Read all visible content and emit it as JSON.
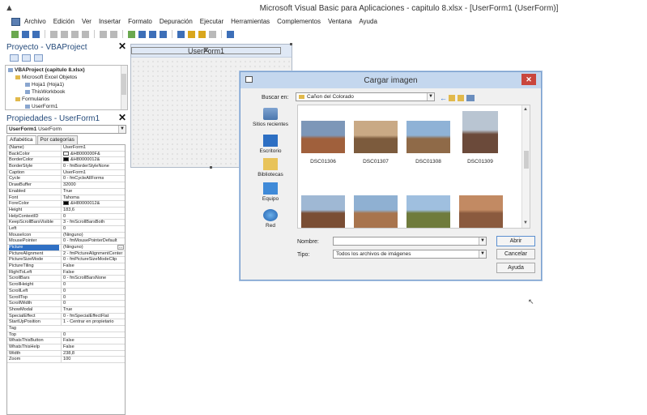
{
  "window": {
    "title": "Microsoft Visual Basic para Aplicaciones - capitulo 8.xlsx - [UserForm1 (UserForm)]"
  },
  "menu": [
    "Archivo",
    "Edición",
    "Ver",
    "Insertar",
    "Formato",
    "Depuración",
    "Ejecutar",
    "Herramientas",
    "Complementos",
    "Ventana",
    "Ayuda"
  ],
  "project": {
    "title": "Proyecto - VBAProject",
    "tree": [
      "VBAProject (capitulo 8.xlsx)",
      "Microsoft Excel Objetos",
      "Hoja1 (Hoja1)",
      "ThisWorkbook",
      "Formularios",
      "UserForm1"
    ]
  },
  "properties": {
    "title": "Propiedades - UserForm1",
    "object_name": "UserForm1",
    "object_type": "UserForm",
    "tabs": [
      "Alfabética",
      "Por categorías"
    ],
    "rows": [
      {
        "name": "(Name)",
        "value": "UserForm1"
      },
      {
        "name": "BackColor",
        "value": "&H8000000F&",
        "swatch": "#ffffff"
      },
      {
        "name": "BorderColor",
        "value": "&H80000012&",
        "swatch": "#000000"
      },
      {
        "name": "BorderStyle",
        "value": "0 - fmBorderStyleNone"
      },
      {
        "name": "Caption",
        "value": "UserForm1"
      },
      {
        "name": "Cycle",
        "value": "0 - fmCycleAllForms"
      },
      {
        "name": "DrawBuffer",
        "value": "32000"
      },
      {
        "name": "Enabled",
        "value": "True"
      },
      {
        "name": "Font",
        "value": "Tahoma"
      },
      {
        "name": "ForeColor",
        "value": "&H80000012&",
        "swatch": "#000000"
      },
      {
        "name": "Height",
        "value": "183,6"
      },
      {
        "name": "HelpContextID",
        "value": "0"
      },
      {
        "name": "KeepScrollBarsVisible",
        "value": "3 - fmScrollBarsBoth"
      },
      {
        "name": "Left",
        "value": "0"
      },
      {
        "name": "MouseIcon",
        "value": "(Ninguno)"
      },
      {
        "name": "MousePointer",
        "value": "0 - fmMousePointerDefault"
      },
      {
        "name": "Picture",
        "value": "(Ninguno)",
        "selected": true
      },
      {
        "name": "PictureAlignment",
        "value": "2 - fmPictureAlignmentCenter"
      },
      {
        "name": "PictureSizeMode",
        "value": "0 - fmPictureSizeModeClip"
      },
      {
        "name": "PictureTiling",
        "value": "False"
      },
      {
        "name": "RightToLeft",
        "value": "False"
      },
      {
        "name": "ScrollBars",
        "value": "0 - fmScrollBarsNone"
      },
      {
        "name": "ScrollHeight",
        "value": "0"
      },
      {
        "name": "ScrollLeft",
        "value": "0"
      },
      {
        "name": "ScrollTop",
        "value": "0"
      },
      {
        "name": "ScrollWidth",
        "value": "0"
      },
      {
        "name": "ShowModal",
        "value": "True"
      },
      {
        "name": "SpecialEffect",
        "value": "0 - fmSpecialEffectFlat"
      },
      {
        "name": "StartUpPosition",
        "value": "1 - Centrar en propietario"
      },
      {
        "name": "Tag",
        "value": ""
      },
      {
        "name": "Top",
        "value": "0"
      },
      {
        "name": "WhatsThisButton",
        "value": "False"
      },
      {
        "name": "WhatsThisHelp",
        "value": "False"
      },
      {
        "name": "Width",
        "value": "238,8"
      },
      {
        "name": "Zoom",
        "value": "100"
      }
    ]
  },
  "userform": {
    "caption": "UserForm1"
  },
  "dialog": {
    "title": "Cargar imagen",
    "look_in_label": "Buscar en:",
    "look_in_value": "Cañon del Colorado",
    "places": [
      "Sitios recientes",
      "Escritorio",
      "Bibliotecas",
      "Equipo",
      "Red"
    ],
    "files": [
      {
        "name": "DSC01306",
        "colors": [
          "#7d97b8",
          "#a0603c"
        ]
      },
      {
        "name": "DSC01307",
        "colors": [
          "#c9a985",
          "#7c5b3d"
        ]
      },
      {
        "name": "DSC01308",
        "colors": [
          "#8fb2d6",
          "#8f6a48"
        ]
      },
      {
        "name": "DSC01309",
        "colors": [
          "#b9c5d2",
          "#6b4a3a"
        ]
      },
      {
        "name": "",
        "colors": [
          "#9fb8d4",
          "#7a4e34"
        ]
      },
      {
        "name": "",
        "colors": [
          "#8fb0d2",
          "#a8744d"
        ]
      },
      {
        "name": "",
        "colors": [
          "#9fbfdf",
          "#6f7b3c"
        ]
      },
      {
        "name": "",
        "colors": [
          "#c28a63",
          "#8a5a3e"
        ]
      }
    ],
    "filename_label": "Nombre:",
    "filename_value": "",
    "filetype_label": "Tipo:",
    "filetype_value": "Todos los archivos de imágenes",
    "buttons": {
      "open": "Abrir",
      "cancel": "Cancelar",
      "help": "Ayuda"
    }
  }
}
